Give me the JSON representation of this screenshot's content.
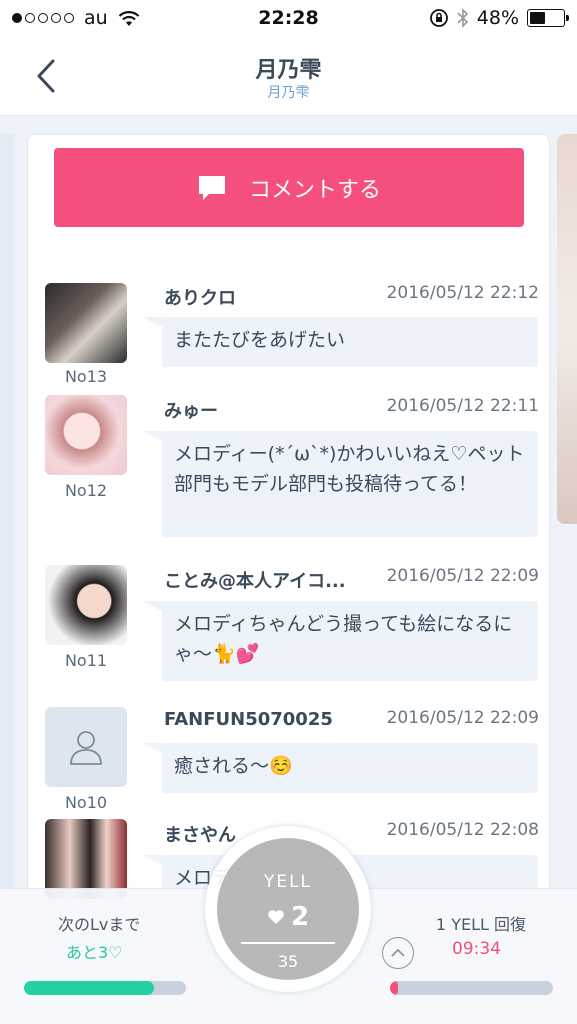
{
  "status_bar": {
    "carrier": "au",
    "time": "22:28",
    "battery": "48%",
    "signal_bars_filled": 1,
    "signal_bars_total": 5,
    "icons": [
      "wifi-icon",
      "rotation-lock-icon",
      "bluetooth-icon",
      "battery-icon"
    ]
  },
  "nav": {
    "title": "月乃雫",
    "subtitle": "月乃雫",
    "back_icon": "chevron-left-icon"
  },
  "comment_button": {
    "label": "コメントする",
    "icon": "speech-bubble-icon",
    "color": "#f5507d"
  },
  "comments": [
    {
      "no": "No13",
      "author": "ありクロ",
      "date": "2016/05/12 22:12",
      "text": "またたびをあげたい"
    },
    {
      "no": "No12",
      "author": "みゅー",
      "date": "2016/05/12 22:11",
      "text": "メロディー(*´ω`*)かわいいねえ♡ペット部門もモデル部門も投稿待ってる！"
    },
    {
      "no": "No11",
      "author": "ことみ@本人アイコ...",
      "date": "2016/05/12 22:09",
      "text": "メロディちゃんどう撮っても絵になるにゃ〜🐈💕"
    },
    {
      "no": "No10",
      "author": "FANFUN5070025",
      "date": "2016/05/12 22:09",
      "text": "癒される〜☺️"
    },
    {
      "no": "",
      "author": "まさやん",
      "date": "2016/05/12 22:08",
      "text": "メロディ〜可愛い！"
    }
  ],
  "bottom": {
    "next_lv_label": "次のLvまで",
    "next_lv_value": "あと3♡",
    "next_lv_progress": 0.8,
    "recovery_label": "1 YELL 回復",
    "recovery_time": "09:34",
    "recovery_progress": 0.05
  },
  "yell": {
    "label": "YELL",
    "count": "2",
    "max": "35"
  }
}
